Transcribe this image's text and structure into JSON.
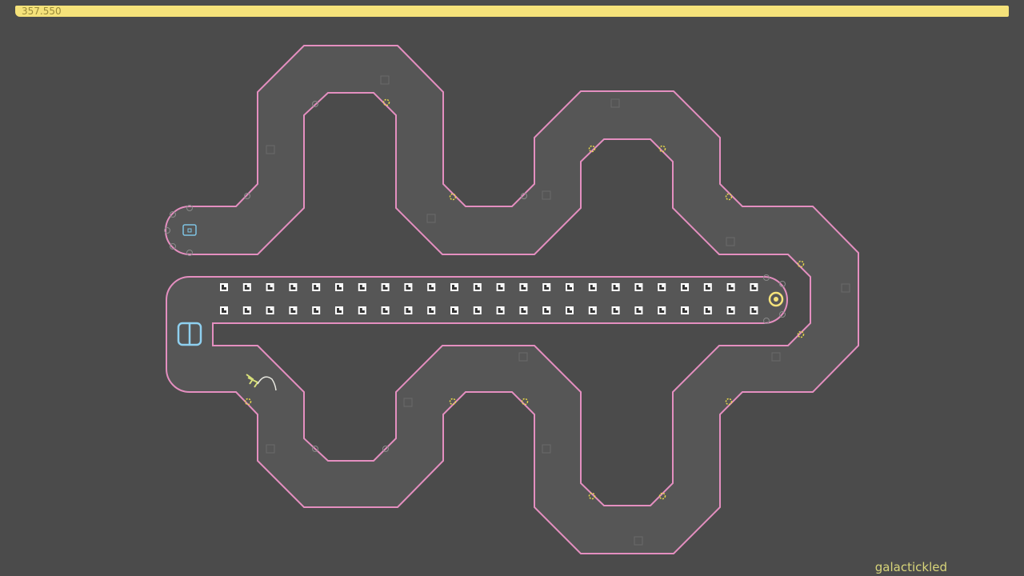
{
  "hud": {
    "time_remaining": "357.550",
    "player_name": "galactickled"
  },
  "colors": {
    "background": "#4b4b4b",
    "track_fill": "#565656",
    "track_outline": "#e48fc0",
    "time_bar": "#f5e27a",
    "gold": "#ffffff",
    "door": "#8fd0f0",
    "mine": "#e8d84a",
    "exit_switch": "#f5e27a"
  },
  "level": {
    "gold_rows": 2,
    "gold_per_row": 24
  }
}
